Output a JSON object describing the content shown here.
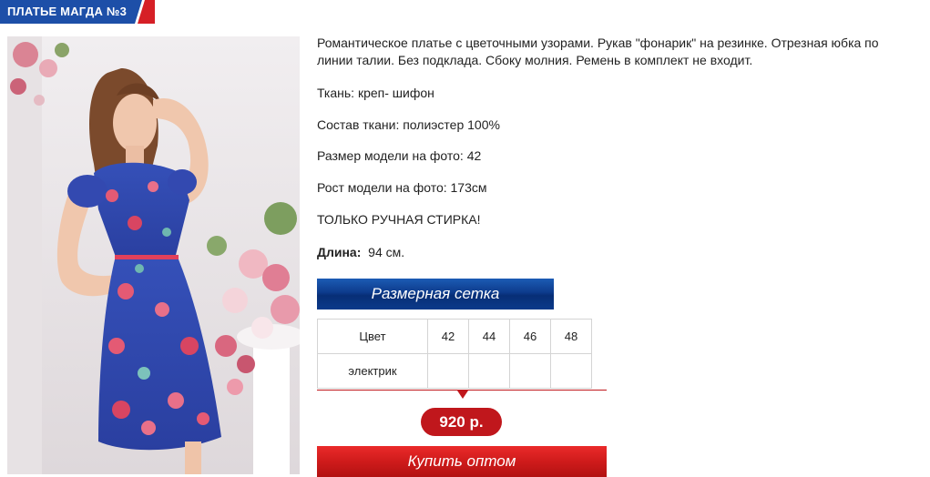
{
  "header": {
    "title": "ПЛАТЬЕ МАГДА №3"
  },
  "product": {
    "description": " Романтическое платье с цветочными узорами. Рукав \"фонарик\" на резинке. Отрезная юбка по линии талии. Без подклада. Сбоку молния. Ремень в комплект не входит.",
    "fabric": "Ткань: креп- шифон",
    "composition": "Состав ткани: полиэстер 100%",
    "model_size": "Размер модели на фото: 42",
    "model_height": "Рост модели на фото: 173см",
    "care": "ТОЛЬКО РУЧНАЯ СТИРКА!",
    "length_label": "Длина:",
    "length_value": "94 см."
  },
  "size_chart_button": "Размерная сетка",
  "size_table": {
    "header": [
      "Цвет",
      "42",
      "44",
      "46",
      "48"
    ],
    "rows": [
      [
        "электрик",
        "",
        "",
        "",
        ""
      ]
    ]
  },
  "price": "920 р.",
  "buy_button": "Купить оптом",
  "colors": {
    "title_bg": "#1d4fa8",
    "title_accent": "#d61f26",
    "size_button": "#0d3b8c",
    "price": "#c0171c",
    "buy_button": "#cf1b1b"
  }
}
